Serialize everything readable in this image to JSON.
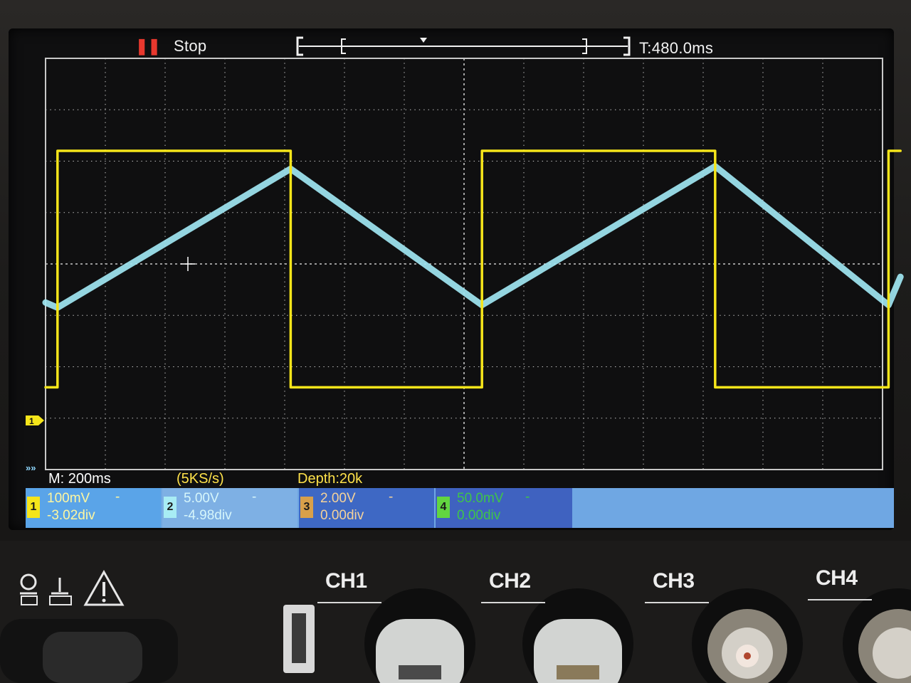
{
  "topbar": {
    "run_state": "Stop",
    "trigger_time": "T:480.0ms"
  },
  "statusbar": {
    "timebase": "M: 200ms",
    "sample_rate": "(5KS/s)",
    "memory_depth": "Depth:20k"
  },
  "channels": [
    {
      "number": "1",
      "scale": "100mV",
      "coupling": "-",
      "offset": "-3.02div",
      "color": "#f5e51a",
      "box_bg": "#5aa4e8",
      "text": "#fff7a0"
    },
    {
      "number": "2",
      "scale": "5.00V",
      "coupling": "-",
      "offset": "-4.98div",
      "color": "#a8ecf4",
      "box_bg": "#7eb0e4",
      "text": "#d6f6fb"
    },
    {
      "number": "3",
      "scale": "2.00V",
      "coupling": "-",
      "offset": "0.00div",
      "color": "#d8a04a",
      "box_bg": "#3e68c4",
      "text": "#f6d39a"
    },
    {
      "number": "4",
      "scale": "50.0mV",
      "coupling": "-",
      "offset": "0.00div",
      "color": "#62d640",
      "box_bg": "#3f62c0",
      "text": "#3fc44a"
    }
  ],
  "front_panel": {
    "ch1_label": "CH1",
    "ch2_label": "CH2",
    "ch3_label": "CH3",
    "ch4_label": "CH4",
    "icons": [
      "probe-comp-icon",
      "ground-icon",
      "warning-icon"
    ]
  },
  "colors": {
    "grid": "#c8c8c8",
    "ch1_trace": "#f5e51a",
    "ch2_trace": "#9fe6f2",
    "stop_indicator": "#e8382e"
  },
  "chart_data": {
    "type": "line",
    "grid": true,
    "x_divisions": 14,
    "y_divisions": 8,
    "x": [
      0.0,
      0.2,
      0.2,
      4.1,
      4.1,
      7.3,
      7.3,
      11.2,
      11.2,
      14.1,
      14.1,
      14.3
    ],
    "series": [
      {
        "values": [
          -2.4,
          -2.4,
          2.2,
          2.2,
          -2.4,
          -2.4,
          2.2,
          2.2,
          -2.4,
          -2.4,
          2.2,
          2.2
        ]
      },
      {
        "values": [
          -0.75,
          -0.85,
          -0.85,
          1.85,
          1.85,
          -0.8,
          -0.8,
          1.9,
          1.9,
          -0.8,
          -0.8,
          -0.25
        ]
      }
    ]
  }
}
